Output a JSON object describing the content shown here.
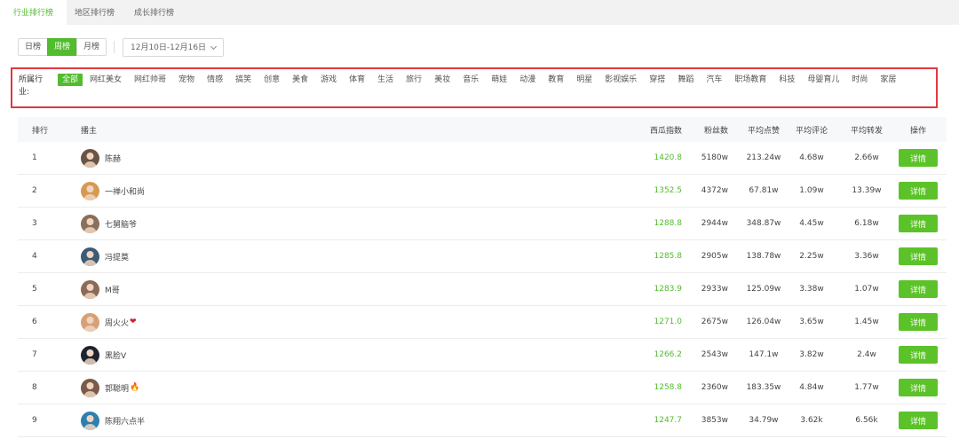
{
  "tabs": [
    "行业排行榜",
    "地区排行榜",
    "成长排行榜"
  ],
  "period": {
    "buttons": [
      "日榜",
      "周榜",
      "月榜"
    ],
    "active": 1,
    "date_range": "12月10日-12月16日"
  },
  "category": {
    "label": "所属行业:",
    "items": [
      "全部",
      "网红美女",
      "网红帅哥",
      "宠物",
      "情感",
      "搞笑",
      "创意",
      "美食",
      "游戏",
      "体育",
      "生活",
      "旅行",
      "美妆",
      "音乐",
      "萌娃",
      "动漫",
      "教育",
      "明星",
      "影视娱乐",
      "穿搭",
      "舞蹈",
      "汽车",
      "职场教育",
      "科技",
      "母婴育儿",
      "时尚",
      "家居"
    ],
    "active": 0
  },
  "table": {
    "headers": [
      "排行",
      "播主",
      "西瓜指数",
      "粉丝数",
      "平均点赞",
      "平均评论",
      "平均转发",
      "操作"
    ],
    "rows": [
      {
        "rank": "1",
        "name": "陈赫",
        "emoji": "",
        "index": "1420.8",
        "fans": "5180w",
        "likes": "213.24w",
        "comments": "4.68w",
        "shares": "2.66w",
        "action": "详情",
        "avatar_color": "#6b5444"
      },
      {
        "rank": "2",
        "name": "一禅小和尚",
        "emoji": "",
        "index": "1352.5",
        "fans": "4372w",
        "likes": "67.81w",
        "comments": "1.09w",
        "shares": "13.39w",
        "action": "详情",
        "avatar_color": "#d79a52"
      },
      {
        "rank": "3",
        "name": "七舅脑爷",
        "emoji": "",
        "index": "1288.8",
        "fans": "2944w",
        "likes": "348.87w",
        "comments": "4.45w",
        "shares": "6.18w",
        "action": "详情",
        "avatar_color": "#8a6f5a"
      },
      {
        "rank": "4",
        "name": "冯提莫",
        "emoji": "",
        "index": "1285.8",
        "fans": "2905w",
        "likes": "138.78w",
        "comments": "2.25w",
        "shares": "3.36w",
        "action": "详情",
        "avatar_color": "#3c5b74"
      },
      {
        "rank": "5",
        "name": "M哥",
        "emoji": "",
        "index": "1283.9",
        "fans": "2933w",
        "likes": "125.09w",
        "comments": "3.38w",
        "shares": "1.07w",
        "action": "详情",
        "avatar_color": "#8c6a58"
      },
      {
        "rank": "6",
        "name": "周火火",
        "emoji": "❤",
        "index": "1271.0",
        "fans": "2675w",
        "likes": "126.04w",
        "comments": "3.65w",
        "shares": "1.45w",
        "action": "详情",
        "avatar_color": "#d7a077"
      },
      {
        "rank": "7",
        "name": "黑脸V",
        "emoji": "",
        "index": "1266.2",
        "fans": "2543w",
        "likes": "147.1w",
        "comments": "3.82w",
        "shares": "2.4w",
        "action": "详情",
        "avatar_color": "#1f2330"
      },
      {
        "rank": "8",
        "name": "郭聪明",
        "emoji": "🔥",
        "index": "1258.8",
        "fans": "2360w",
        "likes": "183.35w",
        "comments": "4.84w",
        "shares": "1.77w",
        "action": "详情",
        "avatar_color": "#7a5a48"
      },
      {
        "rank": "9",
        "name": "陈翔六点半",
        "emoji": "",
        "index": "1247.7",
        "fans": "3853w",
        "likes": "34.79w",
        "comments": "3.62k",
        "shares": "6.56k",
        "action": "详情",
        "avatar_color": "#2e7fb0"
      }
    ]
  },
  "colors": {
    "accent": "#52bb2e",
    "highlight_border": "#e0383e"
  }
}
